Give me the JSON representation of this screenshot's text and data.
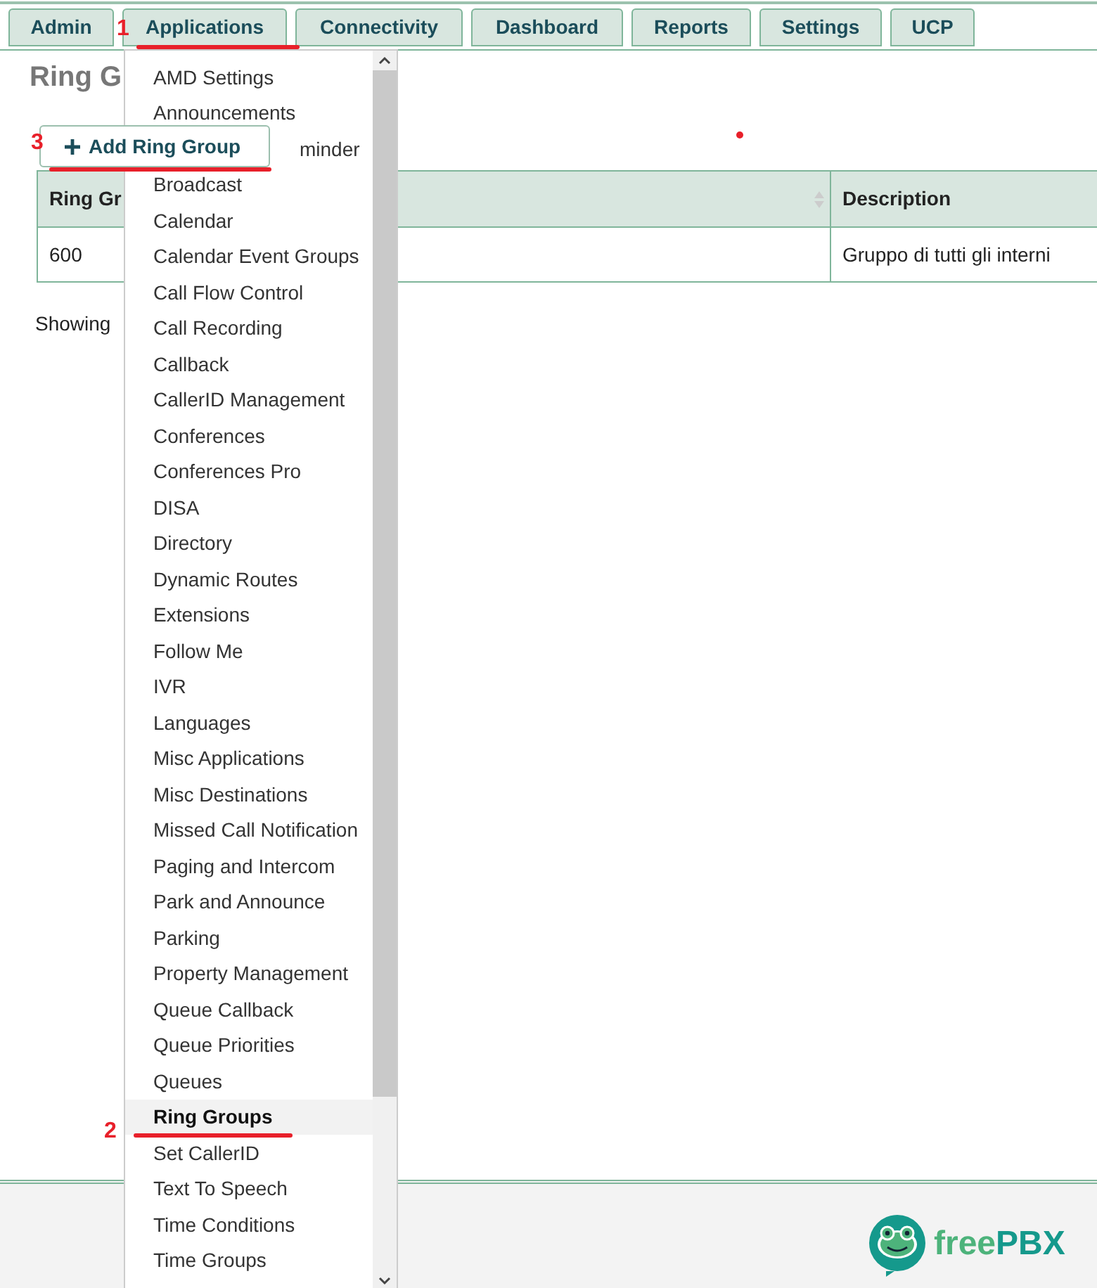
{
  "nav_tabs": [
    {
      "label": "Admin"
    },
    {
      "label": "Applications"
    },
    {
      "label": "Connectivity"
    },
    {
      "label": "Dashboard"
    },
    {
      "label": "Reports"
    },
    {
      "label": "Settings"
    },
    {
      "label": "UCP"
    }
  ],
  "page_title": "Ring G",
  "add_button": {
    "label": "Add Ring Group"
  },
  "table": {
    "columns": [
      "Ring Gr",
      "Description"
    ],
    "rows": [
      [
        "600",
        "Gruppo di tutti gli interni"
      ]
    ]
  },
  "footer_text": "Showing",
  "applications_menu": {
    "items": [
      {
        "label": "AMD Settings",
        "selected": false
      },
      {
        "label": "Announcements",
        "selected": false
      },
      {
        "label": "minder",
        "selected": false,
        "kind": "partial"
      },
      {
        "label": "Broadcast",
        "selected": false
      },
      {
        "label": "Calendar",
        "selected": false
      },
      {
        "label": "Calendar Event Groups",
        "selected": false
      },
      {
        "label": "Call Flow Control",
        "selected": false
      },
      {
        "label": "Call Recording",
        "selected": false
      },
      {
        "label": "Callback",
        "selected": false
      },
      {
        "label": "CallerID Management",
        "selected": false
      },
      {
        "label": "Conferences",
        "selected": false
      },
      {
        "label": "Conferences Pro",
        "selected": false
      },
      {
        "label": "DISA",
        "selected": false
      },
      {
        "label": "Directory",
        "selected": false
      },
      {
        "label": "Dynamic Routes",
        "selected": false
      },
      {
        "label": "Extensions",
        "selected": false
      },
      {
        "label": "Follow Me",
        "selected": false
      },
      {
        "label": "IVR",
        "selected": false
      },
      {
        "label": "Languages",
        "selected": false
      },
      {
        "label": "Misc Applications",
        "selected": false
      },
      {
        "label": "Misc Destinations",
        "selected": false
      },
      {
        "label": "Missed Call Notification",
        "selected": false
      },
      {
        "label": "Paging and Intercom",
        "selected": false
      },
      {
        "label": "Park and Announce",
        "selected": false
      },
      {
        "label": "Parking",
        "selected": false
      },
      {
        "label": "Property Management",
        "selected": false
      },
      {
        "label": "Queue Callback",
        "selected": false
      },
      {
        "label": "Queue Priorities",
        "selected": false
      },
      {
        "label": "Queues",
        "selected": false
      },
      {
        "label": "Ring Groups",
        "selected": true
      },
      {
        "label": "Set CallerID",
        "selected": false
      },
      {
        "label": "Text To Speech",
        "selected": false
      },
      {
        "label": "Time Conditions",
        "selected": false
      },
      {
        "label": "Time Groups",
        "selected": false
      }
    ]
  },
  "annotations": [
    {
      "label": "1"
    },
    {
      "label": "2"
    },
    {
      "label": "3"
    }
  ],
  "logo": {
    "part_1": "free",
    "part_2": "PBX"
  }
}
